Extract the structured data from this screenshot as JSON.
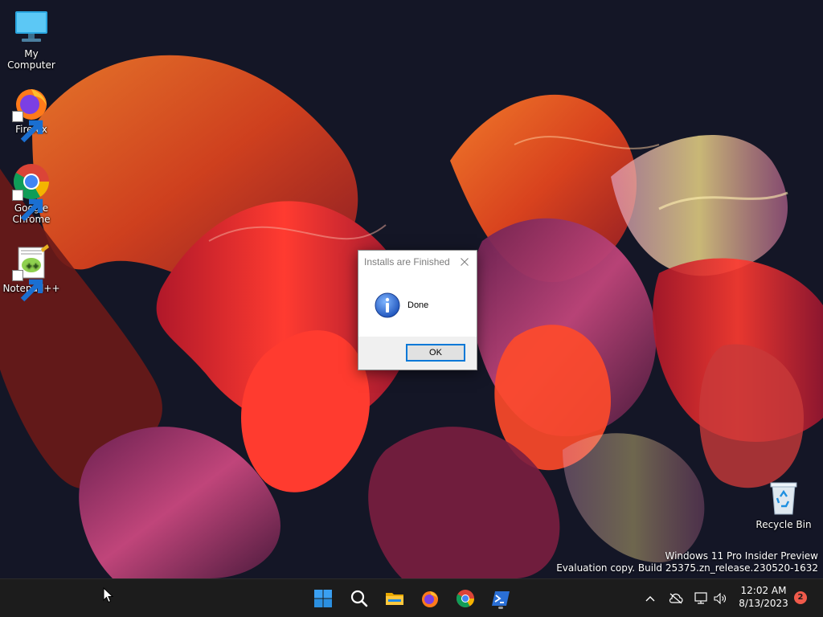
{
  "desktop": {
    "icons": [
      {
        "label": "My Computer",
        "icon": "computer-icon"
      },
      {
        "label": "Firefox",
        "icon": "firefox-icon"
      },
      {
        "label": "Google Chrome",
        "icon": "chrome-icon"
      },
      {
        "label": "Notepad++",
        "icon": "notepadpp-icon"
      },
      {
        "label": "Recycle Bin",
        "icon": "recycle-bin-icon"
      }
    ],
    "watermark": {
      "line1": "Windows 11 Pro Insider Preview",
      "line2": "Evaluation copy. Build 25375.zn_release.230520-1632"
    }
  },
  "dialog": {
    "title": "Installs are Finished",
    "message": "Done",
    "ok_label": "OK",
    "icon": "info-icon"
  },
  "taskbar": {
    "pinned": [
      {
        "name": "Start",
        "icon": "windows-start-icon"
      },
      {
        "name": "Search",
        "icon": "search-icon"
      },
      {
        "name": "File Explorer",
        "icon": "folder-icon"
      },
      {
        "name": "Firefox",
        "icon": "firefox-icon"
      },
      {
        "name": "Google Chrome",
        "icon": "chrome-icon"
      },
      {
        "name": "PowerShell",
        "icon": "powershell-icon"
      }
    ],
    "tray": {
      "time": "12:02 AM",
      "date": "8/13/2023",
      "notification_count": "2"
    }
  },
  "colors": {
    "taskbar_bg": "#1c1c1c",
    "accent": "#0078d7",
    "badge": "#f05a4b"
  }
}
